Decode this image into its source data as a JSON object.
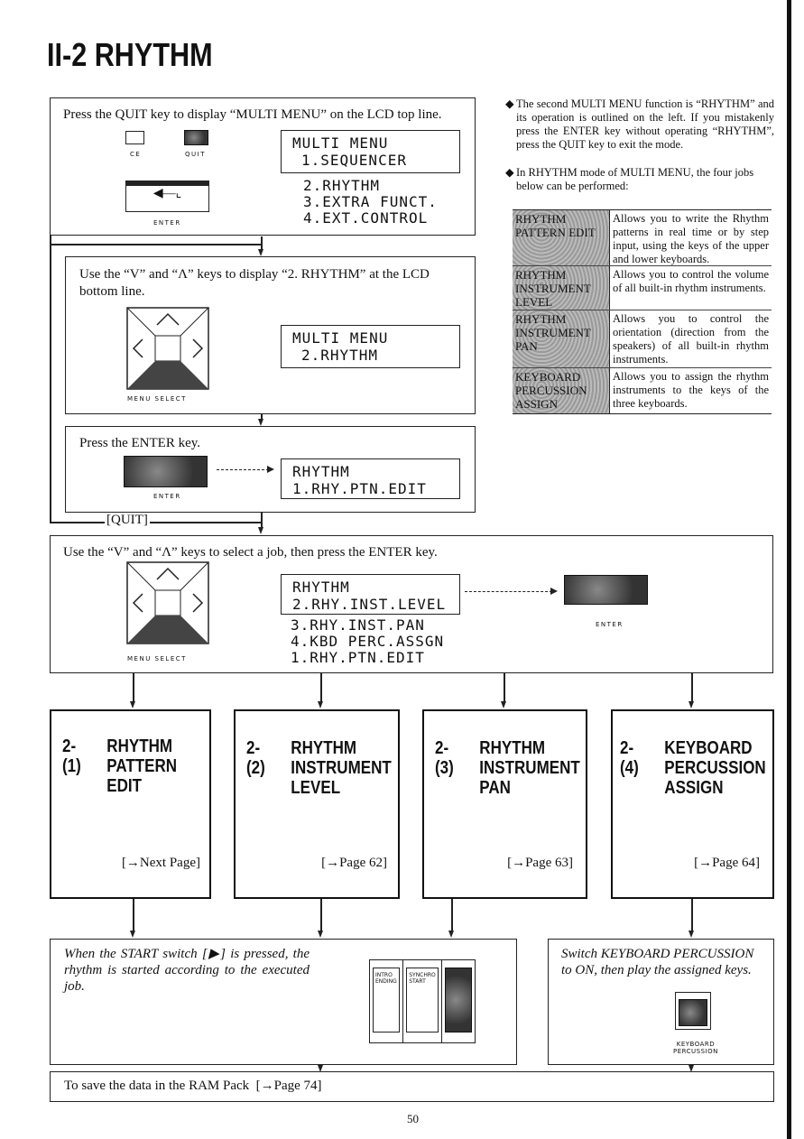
{
  "title": "II-2 RHYTHM",
  "step1": {
    "text": "Press the QUIT key to display “MULTI MENU” on the LCD top line.",
    "ce_label": "CE",
    "quit_label": "QUIT",
    "enter_label": "ENTER",
    "lcd": [
      "MULTI MENU",
      "1.SEQUENCER"
    ],
    "menu": [
      "2.RHYTHM",
      "3.EXTRA FUNCT.",
      "4.EXT.CONTROL"
    ]
  },
  "step2": {
    "text": "Use the “V” and “Λ” keys to display “2. RHYTHM” at the LCD bottom line.",
    "pad_label": "MENU SELECT",
    "lcd": [
      "MULTI MENU",
      "2.RHYTHM"
    ]
  },
  "step3": {
    "text": "Press the ENTER key.",
    "enter_label": "ENTER",
    "lcd": [
      "RHYTHM",
      "1.RHY.PTN.EDIT"
    ],
    "quit_label": "[QUIT]"
  },
  "step4": {
    "text": "Use the “V” and “Λ” keys to select a job, then press the ENTER key.",
    "pad_label": "MENU SELECT",
    "lcd": [
      "RHYTHM",
      "2.RHY.INST.LEVEL"
    ],
    "menu": [
      "3.RHY.INST.PAN",
      "4.KBD PERC.ASSGN",
      "1.RHY.PTN.EDIT"
    ],
    "enter_label": "ENTER"
  },
  "jobs": [
    {
      "num": "2-(1)",
      "name": "RHYTHM\nPATTERN\nEDIT",
      "ref": "[→Next Page]"
    },
    {
      "num": "2-(2)",
      "name": "RHYTHM\nINSTRUMENT\nLEVEL",
      "ref": "[→Page 62]"
    },
    {
      "num": "2-(3)",
      "name": "RHYTHM\nINSTRUMENT\nPAN",
      "ref": "[→Page 63]"
    },
    {
      "num": "2-(4)",
      "name": "KEYBOARD\nPERCUSSION\nASSIGN",
      "ref": "[→Page 64]"
    }
  ],
  "start_box": {
    "text": "When the START switch [▶] is pressed, the rhythm is started according to the executed job.",
    "btn1": "INTRO\nENDING",
    "btn2": "SYNCHRO\nSTART"
  },
  "kbd_box": {
    "text": "Switch KEYBOARD PERCUSSION to ON, then play the assigned keys.",
    "label": "KEYBOARD\nPERCUSSION"
  },
  "save": {
    "text": "To save the data in the RAM Pack  [→Page 74]"
  },
  "notes": [
    "The second MULTI MENU function is “RHYTHM” and its operation is outlined on the left. If you mistakenly press the ENTER key without operating “RHYTHM”, press the QUIT key to exit the mode.",
    "In RHYTHM mode of MULTI MENU, the four jobs below can be performed:"
  ],
  "table": [
    {
      "job": "RHYTHM PATTERN EDIT",
      "desc": "Allows you to write the Rhythm patterns in real time or by step input, using the keys of the upper and lower keyboards."
    },
    {
      "job": "RHYTHM INSTRUMENT LEVEL",
      "desc": "Allows you to control the volume of all built-in rhythm instruments."
    },
    {
      "job": "RHYTHM INSTRUMENT PAN",
      "desc": "Allows you to control the orientation (direction from the speakers) of all built-in rhythm instruments."
    },
    {
      "job": "KEYBOARD PERCUSSION ASSIGN",
      "desc": "Allows you to assign the rhythm instruments to the keys of the three keyboards."
    }
  ],
  "page_number": "50"
}
